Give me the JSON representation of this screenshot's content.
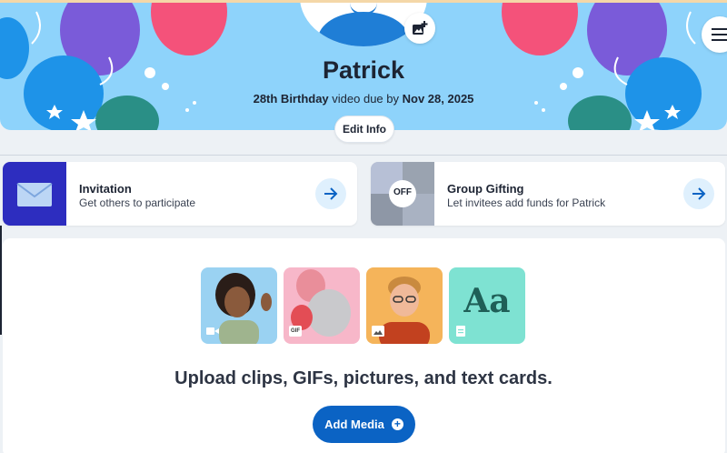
{
  "header": {
    "name": "Patrick",
    "due_prefix": "28th Birthday",
    "due_middle": " video due by ",
    "due_date": "Nov 28, 2025",
    "edit_label": "Edit Info"
  },
  "cards": [
    {
      "title": "Invitation",
      "subtitle": "Get others to participate"
    },
    {
      "title": "Group Gifting",
      "subtitle": "Let invitees add funds for Patrick",
      "thumb_label": "OFF"
    }
  ],
  "media": {
    "tiles": [
      "video",
      "gif",
      "picture",
      "text"
    ],
    "gif_badge": "GIF",
    "text_card_label": "Aa",
    "heading": "Upload clips, GIFs, pictures, and text cards.",
    "add_label": "Add Media"
  },
  "colors": {
    "hero_bg": "#8ed3fb",
    "accent": "#0b63c4",
    "invitation_thumb": "#2d2dbf"
  },
  "icons": {
    "photo": "add-photo-icon",
    "menu": "hamburger-menu-icon",
    "arrow": "arrow-right-icon",
    "envelope": "envelope-icon",
    "plus": "plus-circle-icon"
  }
}
